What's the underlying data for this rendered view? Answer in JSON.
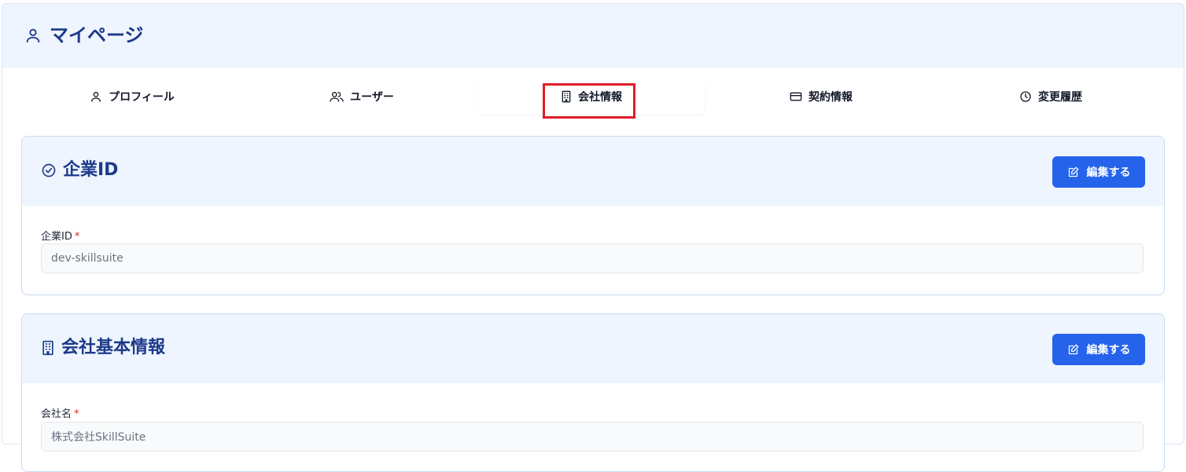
{
  "page": {
    "title": "マイページ"
  },
  "tabs": [
    {
      "label": "プロフィール",
      "icon": "user-icon"
    },
    {
      "label": "ユーザー",
      "icon": "users-icon"
    },
    {
      "label": "会社情報",
      "icon": "building-icon",
      "active": true
    },
    {
      "label": "契約情報",
      "icon": "credit-card-icon"
    },
    {
      "label": "変更履歴",
      "icon": "clock-icon"
    }
  ],
  "company_id_section": {
    "title": "企業ID",
    "edit_label": "編集する",
    "field_label": "企業ID",
    "required_mark": "*",
    "value": "dev-skillsuite"
  },
  "company_info_section": {
    "title": "会社基本情報",
    "edit_label": "編集する",
    "field_label": "会社名",
    "required_mark": "*",
    "value": "株式会社SkillSuite"
  },
  "colors": {
    "accent": "#2563eb",
    "heading": "#1e3a8a",
    "header_bg": "#eef5ff",
    "highlight": "#e11d26"
  }
}
